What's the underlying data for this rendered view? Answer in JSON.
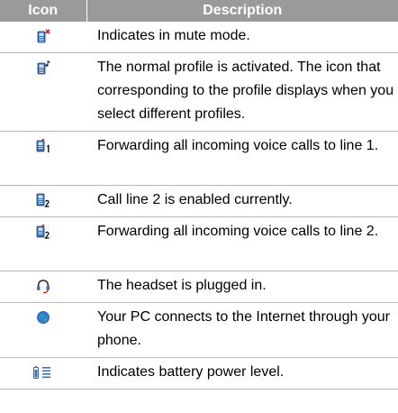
{
  "table": {
    "headers": {
      "icon": "Icon",
      "description": "Description"
    },
    "rows": [
      {
        "icon": "mute-mode-icon",
        "description": "Indicates in mute mode."
      },
      {
        "icon": "normal-profile-icon",
        "description": "The normal profile is activated. The icon that corresponding to the profile displays when you select different profiles."
      },
      {
        "icon": "forward-line1-icon",
        "description": "Forwarding all incoming voice calls to line 1."
      },
      {
        "icon": "call-line2-icon",
        "description": "Call line 2 is enabled currently."
      },
      {
        "icon": "forward-line2-icon",
        "description": "Forwarding all incoming voice calls to line 2."
      },
      {
        "icon": "headset-icon",
        "description": "The headset is plugged in."
      },
      {
        "icon": "internet-globe-icon",
        "description": "Your PC connects to the Internet through your phone."
      },
      {
        "icon": "battery-level-icon",
        "description": "Indicates battery power level."
      }
    ]
  },
  "colors": {
    "header_bg": "#9a9a9a",
    "header_text": "#ffffff",
    "row_border": "#b8b8b8"
  }
}
